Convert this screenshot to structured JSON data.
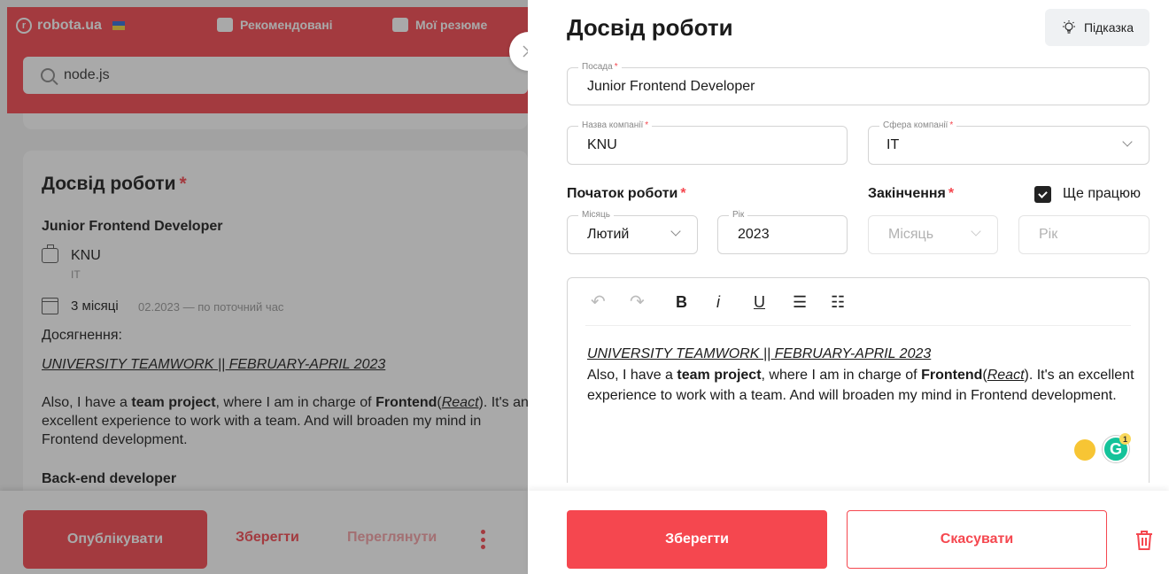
{
  "background": {
    "brand": "robota.ua",
    "nav": [
      "Рекомендовані",
      "Мої резюме"
    ],
    "search_value": "node.js",
    "section_title": "Досвід роботи",
    "job_title": "Junior Frontend Developer",
    "company": "KNU",
    "sector": "IT",
    "duration": "3 місяці",
    "dates": "02.2023 — по поточний час",
    "achievements_label": "Досягнення:",
    "achievements_link": " UNIVERSITY TEAMWORK || FEBRUARY-APRIL 2023",
    "desc": {
      "p1": "Also, I have a ",
      "b1": "team project",
      "p2": ", where I am in charge of ",
      "b2": "Frontend",
      "p3": "(",
      "i1": "React",
      "p4": "). It's an excellent experience to work with a team. And will broaden my mind in Frontend development."
    },
    "next_job": "Back-end developer",
    "publish": "Опублікувати",
    "save": "Зберегти",
    "preview": "Переглянути"
  },
  "panel": {
    "title": "Досвід роботи",
    "hint": "Підказка",
    "position": {
      "label": "Посада",
      "value": "Junior Frontend Developer"
    },
    "company": {
      "label": "Назва компанії",
      "value": "KNU"
    },
    "sector": {
      "label": "Сфера компанії",
      "value": "IT"
    },
    "start_label": "Початок роботи",
    "end_label": "Закінчення",
    "still_working": "Ще працюю",
    "still_working_checked": true,
    "start_month": {
      "label": "Місяць",
      "value": "Лютий"
    },
    "start_year": {
      "label": "Рік",
      "value": "2023"
    },
    "end_month_placeholder": "Місяць",
    "end_year_placeholder": "Рік",
    "editor": {
      "toolbar": [
        "↶",
        "↷",
        "B",
        "i",
        "U",
        "☰",
        "☷"
      ],
      "link": " UNIVERSITY TEAMWORK || FEBRUARY-APRIL 2023",
      "p1": "Also, I have a ",
      "b1": "team project",
      "p2": ", where I am in charge of ",
      "b2": "Frontend",
      "p3": "(",
      "i1": "React",
      "p4": "). It's an excellent experience to work with a team. And will broaden my mind in Frontend development.",
      "grammarly_count": "1"
    },
    "save": "Зберегти",
    "cancel": "Скасувати"
  },
  "colors": {
    "accent": "#f5474f",
    "overlay": "rgba(40,40,40,0.4)"
  }
}
